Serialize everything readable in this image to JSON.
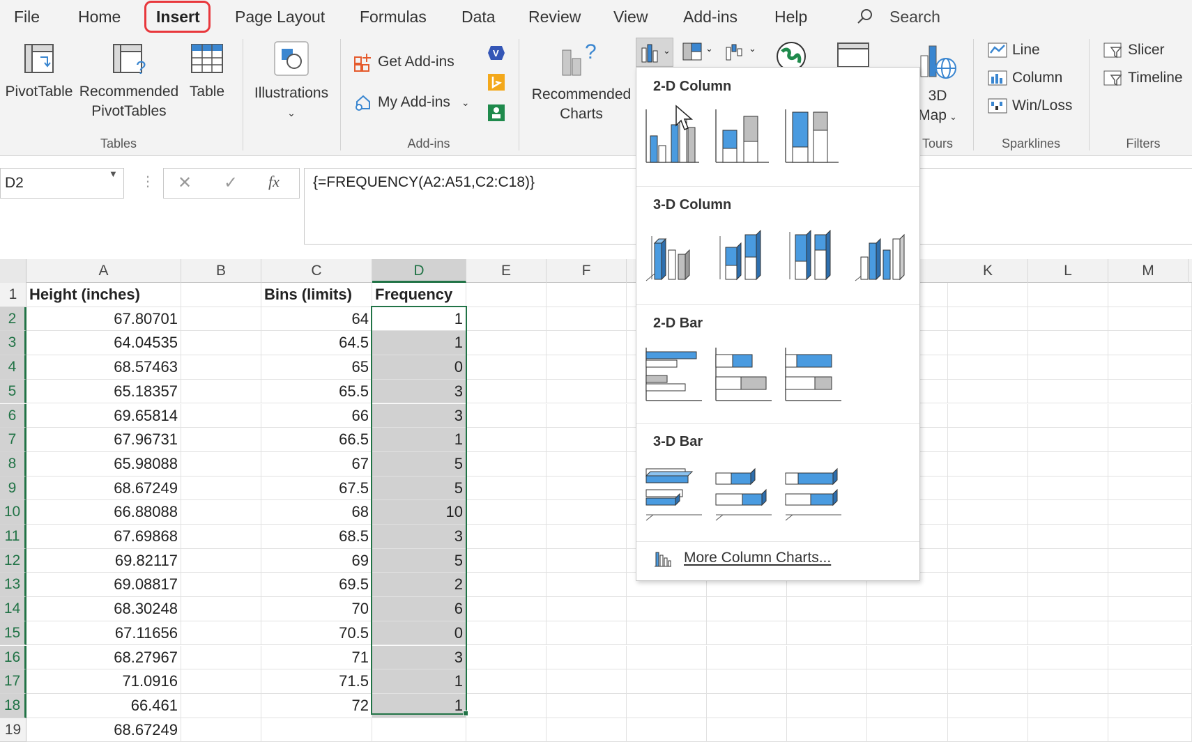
{
  "menu": {
    "tabs": [
      "File",
      "Home",
      "Insert",
      "Page Layout",
      "Formulas",
      "Data",
      "Review",
      "View",
      "Add-ins",
      "Help"
    ],
    "active_tab": "Insert",
    "search_label": "Search"
  },
  "ribbon": {
    "tables": {
      "pivot_table": "PivotTable",
      "rec_pivot_line1": "Recommended",
      "rec_pivot_line2": "PivotTables",
      "table": "Table",
      "group": "Tables"
    },
    "illustrations": {
      "label": "Illustrations"
    },
    "addins": {
      "get_addins": "Get Add-ins",
      "my_addins": "My Add-ins",
      "group": "Add-ins"
    },
    "charts": {
      "rec_line1": "Recommended",
      "rec_line2": "Charts"
    },
    "tours": {
      "map_line1": "3D",
      "map_line2": "Map",
      "group": "Tours"
    },
    "sparklines": {
      "line": "Line",
      "column": "Column",
      "winloss": "Win/Loss",
      "group": "Sparklines"
    },
    "filters": {
      "slicer": "Slicer",
      "timeline": "Timeline",
      "group": "Filters"
    }
  },
  "formula_bar": {
    "name_box": "D2",
    "fx": "fx",
    "formula": "{=FREQUENCY(A2:A51,C2:C18)}"
  },
  "grid": {
    "columns": [
      "A",
      "B",
      "C",
      "D",
      "E",
      "F",
      "K",
      "L",
      "M"
    ],
    "rows": [
      "1",
      "2",
      "3",
      "4",
      "5",
      "6",
      "7",
      "8",
      "9",
      "10",
      "11",
      "12",
      "13",
      "14",
      "15",
      "16",
      "17",
      "18",
      "19"
    ],
    "headers": {
      "A": "Height (inches)",
      "C": "Bins (limits)",
      "D": "Frequency"
    },
    "heights": [
      "67.80701",
      "64.04535",
      "68.57463",
      "65.18357",
      "69.65814",
      "67.96731",
      "65.98088",
      "68.67249",
      "66.88088",
      "67.69868",
      "69.82117",
      "69.08817",
      "68.30248",
      "67.11656",
      "68.27967",
      "71.0916",
      "66.461",
      "68.67249"
    ],
    "bins": [
      "64",
      "64.5",
      "65",
      "65.5",
      "66",
      "66.5",
      "67",
      "67.5",
      "68",
      "68.5",
      "69",
      "69.5",
      "70",
      "70.5",
      "71",
      "71.5",
      "72"
    ],
    "frequency": [
      "1",
      "1",
      "0",
      "3",
      "3",
      "1",
      "5",
      "5",
      "10",
      "3",
      "5",
      "2",
      "6",
      "0",
      "3",
      "1",
      "1"
    ]
  },
  "chart_menu": {
    "section_2d_column": "2-D Column",
    "section_3d_column": "3-D Column",
    "section_2d_bar": "2-D Bar",
    "section_3d_bar": "3-D Bar",
    "more": "More Column Charts...",
    "accent_color": "#4a9be0"
  },
  "colors": {
    "excel_green": "#217346",
    "highlight_red": "#e8373c",
    "selection_fill": "#d1d1d1"
  }
}
